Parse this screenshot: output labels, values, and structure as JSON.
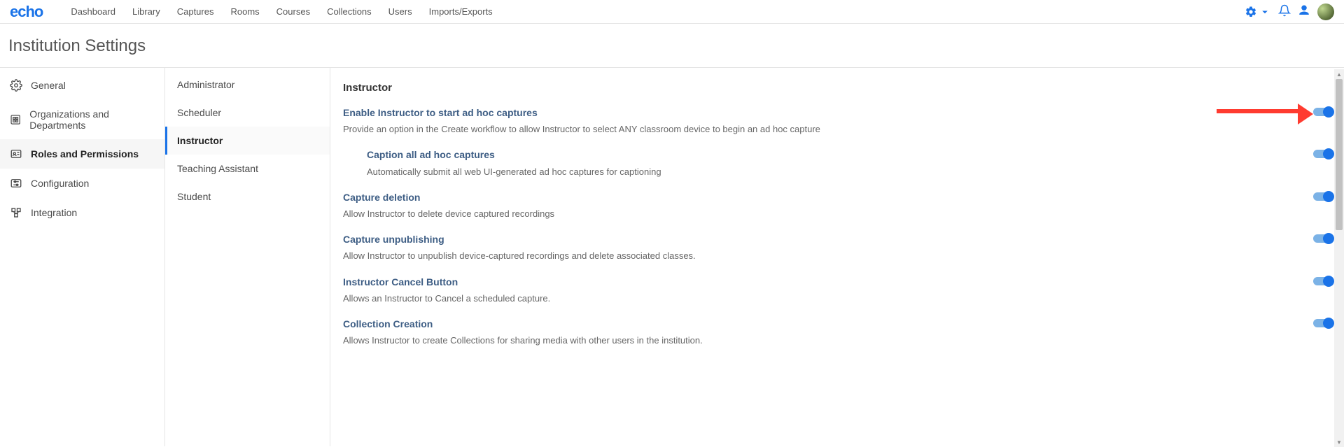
{
  "logo": "echo",
  "topnav": {
    "items": [
      "Dashboard",
      "Library",
      "Captures",
      "Rooms",
      "Courses",
      "Collections",
      "Users",
      "Imports/Exports"
    ]
  },
  "page_title": "Institution Settings",
  "sidebar_primary": {
    "items": [
      {
        "label": "General",
        "icon": "gear-icon"
      },
      {
        "label": "Organizations and Departments",
        "icon": "org-icon"
      },
      {
        "label": "Roles and Permissions",
        "icon": "id-icon",
        "active": true
      },
      {
        "label": "Configuration",
        "icon": "sliders-icon"
      },
      {
        "label": "Integration",
        "icon": "integration-icon"
      }
    ]
  },
  "sidebar_secondary": {
    "items": [
      {
        "label": "Administrator"
      },
      {
        "label": "Scheduler"
      },
      {
        "label": "Instructor",
        "active": true
      },
      {
        "label": "Teaching Assistant"
      },
      {
        "label": "Student"
      }
    ]
  },
  "content": {
    "section_heading": "Instructor",
    "settings": [
      {
        "title": "Enable Instructor to start ad hoc captures",
        "desc": "Provide an option in the Create workflow to allow Instructor to select ANY classroom device to begin an ad hoc capture",
        "on": true,
        "arrow": true
      },
      {
        "title": "Caption all ad hoc captures",
        "desc": "Automatically submit all web UI-generated ad hoc captures for captioning",
        "on": true,
        "nested": true
      },
      {
        "title": "Capture deletion",
        "desc": "Allow Instructor to delete device captured recordings",
        "on": true
      },
      {
        "title": "Capture unpublishing",
        "desc": "Allow Instructor to unpublish device-captured recordings and delete associated classes.",
        "on": true
      },
      {
        "title": "Instructor Cancel Button",
        "desc": "Allows an Instructor to Cancel a scheduled capture.",
        "on": true
      },
      {
        "title": "Collection Creation",
        "desc": "Allows Instructor to create Collections for sharing media with other users in the institution.",
        "on": true
      }
    ]
  }
}
